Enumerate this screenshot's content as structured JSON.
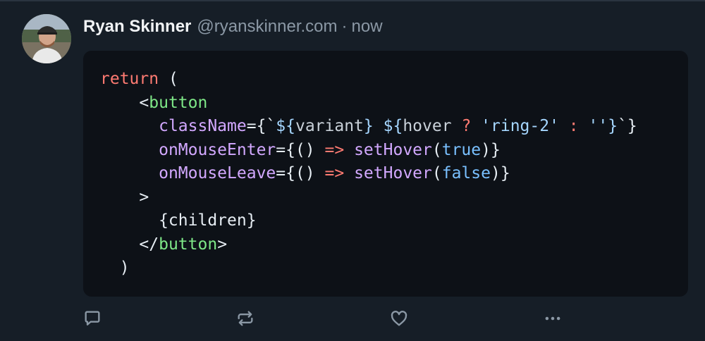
{
  "post": {
    "author_name": "Ryan Skinner",
    "handle": "@ryanskinner.com",
    "separator": "·",
    "timestamp": "now"
  },
  "code": {
    "lines": [
      [
        {
          "t": "keyword",
          "v": "return"
        },
        {
          "t": "punct",
          "v": " ("
        }
      ],
      [
        {
          "t": "punct",
          "v": "    <"
        },
        {
          "t": "tag",
          "v": "button"
        }
      ],
      [
        {
          "t": "punct",
          "v": "      "
        },
        {
          "t": "attr",
          "v": "className"
        },
        {
          "t": "punct",
          "v": "={`"
        },
        {
          "t": "str",
          "v": "${"
        },
        {
          "t": "var",
          "v": "variant"
        },
        {
          "t": "str",
          "v": "}"
        },
        {
          "t": "punct",
          "v": " "
        },
        {
          "t": "str",
          "v": "${"
        },
        {
          "t": "var",
          "v": "hover"
        },
        {
          "t": "punct",
          "v": " "
        },
        {
          "t": "op",
          "v": "?"
        },
        {
          "t": "punct",
          "v": " "
        },
        {
          "t": "str",
          "v": "'ring-2'"
        },
        {
          "t": "punct",
          "v": " "
        },
        {
          "t": "op",
          "v": ":"
        },
        {
          "t": "punct",
          "v": " "
        },
        {
          "t": "str",
          "v": "''"
        },
        {
          "t": "str",
          "v": "}"
        },
        {
          "t": "punct",
          "v": "`}"
        }
      ],
      [
        {
          "t": "punct",
          "v": "      "
        },
        {
          "t": "attr",
          "v": "onMouseEnter"
        },
        {
          "t": "punct",
          "v": "={() "
        },
        {
          "t": "op",
          "v": "=>"
        },
        {
          "t": "punct",
          "v": " "
        },
        {
          "t": "fn",
          "v": "setHover"
        },
        {
          "t": "punct",
          "v": "("
        },
        {
          "t": "bool",
          "v": "true"
        },
        {
          "t": "punct",
          "v": ")}"
        }
      ],
      [
        {
          "t": "punct",
          "v": "      "
        },
        {
          "t": "attr",
          "v": "onMouseLeave"
        },
        {
          "t": "punct",
          "v": "={() "
        },
        {
          "t": "op",
          "v": "=>"
        },
        {
          "t": "punct",
          "v": " "
        },
        {
          "t": "fn",
          "v": "setHover"
        },
        {
          "t": "punct",
          "v": "("
        },
        {
          "t": "bool",
          "v": "false"
        },
        {
          "t": "punct",
          "v": ")}"
        }
      ],
      [
        {
          "t": "punct",
          "v": "    >"
        }
      ],
      [
        {
          "t": "punct",
          "v": "      {children}"
        }
      ],
      [
        {
          "t": "punct",
          "v": "    </"
        },
        {
          "t": "tag",
          "v": "button"
        },
        {
          "t": "punct",
          "v": ">"
        }
      ],
      [
        {
          "t": "punct",
          "v": "  )"
        }
      ]
    ]
  },
  "actions": [
    {
      "name": "reply-icon",
      "label": "Reply"
    },
    {
      "name": "repost-icon",
      "label": "Repost"
    },
    {
      "name": "like-icon",
      "label": "Like"
    },
    {
      "name": "more-icon",
      "label": "More"
    }
  ],
  "colors": {
    "background": "#161e27",
    "code_background": "#0d1117",
    "keyword": "#ff7b72",
    "tag": "#7ee787",
    "attribute": "#d2a8ff",
    "string": "#a5d6ff",
    "boolean": "#79c0ff",
    "muted_text": "#8b98a5",
    "icon": "#8b98a5"
  }
}
